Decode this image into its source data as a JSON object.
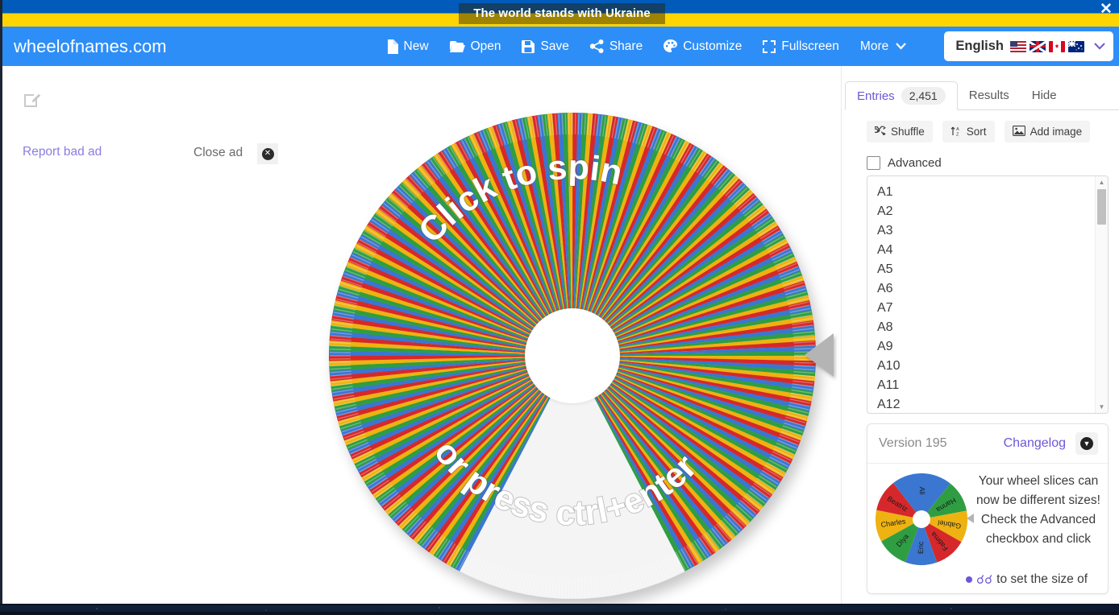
{
  "banner": {
    "text": "The world stands with Ukraine",
    "close_icon": "close-icon",
    "flag_blue": "#005bbb",
    "flag_yellow": "#ffd500"
  },
  "appbar": {
    "brand": "wheelofnames.com",
    "background": "#2e8ef7",
    "items": [
      {
        "label": "New",
        "icon": "file-icon"
      },
      {
        "label": "Open",
        "icon": "folder-open-icon"
      },
      {
        "label": "Save",
        "icon": "floppy-disk-icon"
      },
      {
        "label": "Share",
        "icon": "share-nodes-icon"
      },
      {
        "label": "Customize",
        "icon": "palette-icon"
      },
      {
        "label": "Fullscreen",
        "icon": "expand-icon"
      },
      {
        "label": "More",
        "icon": "chevron-down-icon"
      }
    ],
    "language": {
      "label": "English",
      "flags": [
        "flag-us",
        "flag-uk",
        "flag-ca",
        "flag-au"
      ],
      "caret": "chevron-down-icon"
    }
  },
  "ad": {
    "edit_icon": "edit-square-icon",
    "report_label": "Report bad ad",
    "close_label": "Close ad",
    "close_icon": "close-circle-icon"
  },
  "wheel": {
    "caption_top": "Click to spin",
    "caption_bottom": "or press ctrl+enter",
    "pointer_icon": "wheel-pointer-icon",
    "slice_colors": [
      "#d6282b",
      "#3b76d1",
      "#2f9e43",
      "#eeb211"
    ],
    "blank_wedge_color": "#f2f2f2",
    "hub_color": "#ffffff",
    "slice_count": 2451
  },
  "side": {
    "tabs": [
      {
        "label": "Entries",
        "badge": "2,451",
        "active": true
      },
      {
        "label": "Results",
        "badge": "",
        "active": false
      },
      {
        "label": "Hide",
        "badge": "",
        "active": false
      }
    ],
    "buttons": [
      {
        "label": "Shuffle",
        "icon": "shuffle-icon"
      },
      {
        "label": "Sort",
        "icon": "sort-icon"
      },
      {
        "label": "Add image",
        "icon": "image-icon"
      }
    ],
    "advanced_label": "Advanced",
    "entries": [
      "A1",
      "A2",
      "A3",
      "A4",
      "A5",
      "A6",
      "A7",
      "A8",
      "A9",
      "A10",
      "A11",
      "A12"
    ],
    "scrollbar": {
      "up_icon": "triangle-up-icon",
      "down_icon": "triangle-down-icon"
    }
  },
  "version_card": {
    "title": "Version 195",
    "changelog_label": "Changelog",
    "collapse_icon": "chevron-down-circle-icon",
    "body_text": "Your wheel slices can now be different sizes! Check the Advanced checkbox and click",
    "bullet_text": "to set the size of",
    "mini_wheel": {
      "names": [
        "Ali",
        "Hanna",
        "Gabriel",
        "Fatima",
        "Eric",
        "Diya",
        "Charles",
        "Beatriz"
      ],
      "colors": [
        "#3b76d1",
        "#2f9e43",
        "#eeb211",
        "#d6282b",
        "#3b76d1",
        "#2f9e43",
        "#eeb211",
        "#d6282b"
      ]
    }
  },
  "accents": {
    "purple": "#6e56d8",
    "link_purple": "#8a7de0",
    "blue": "#2e8ef7"
  }
}
